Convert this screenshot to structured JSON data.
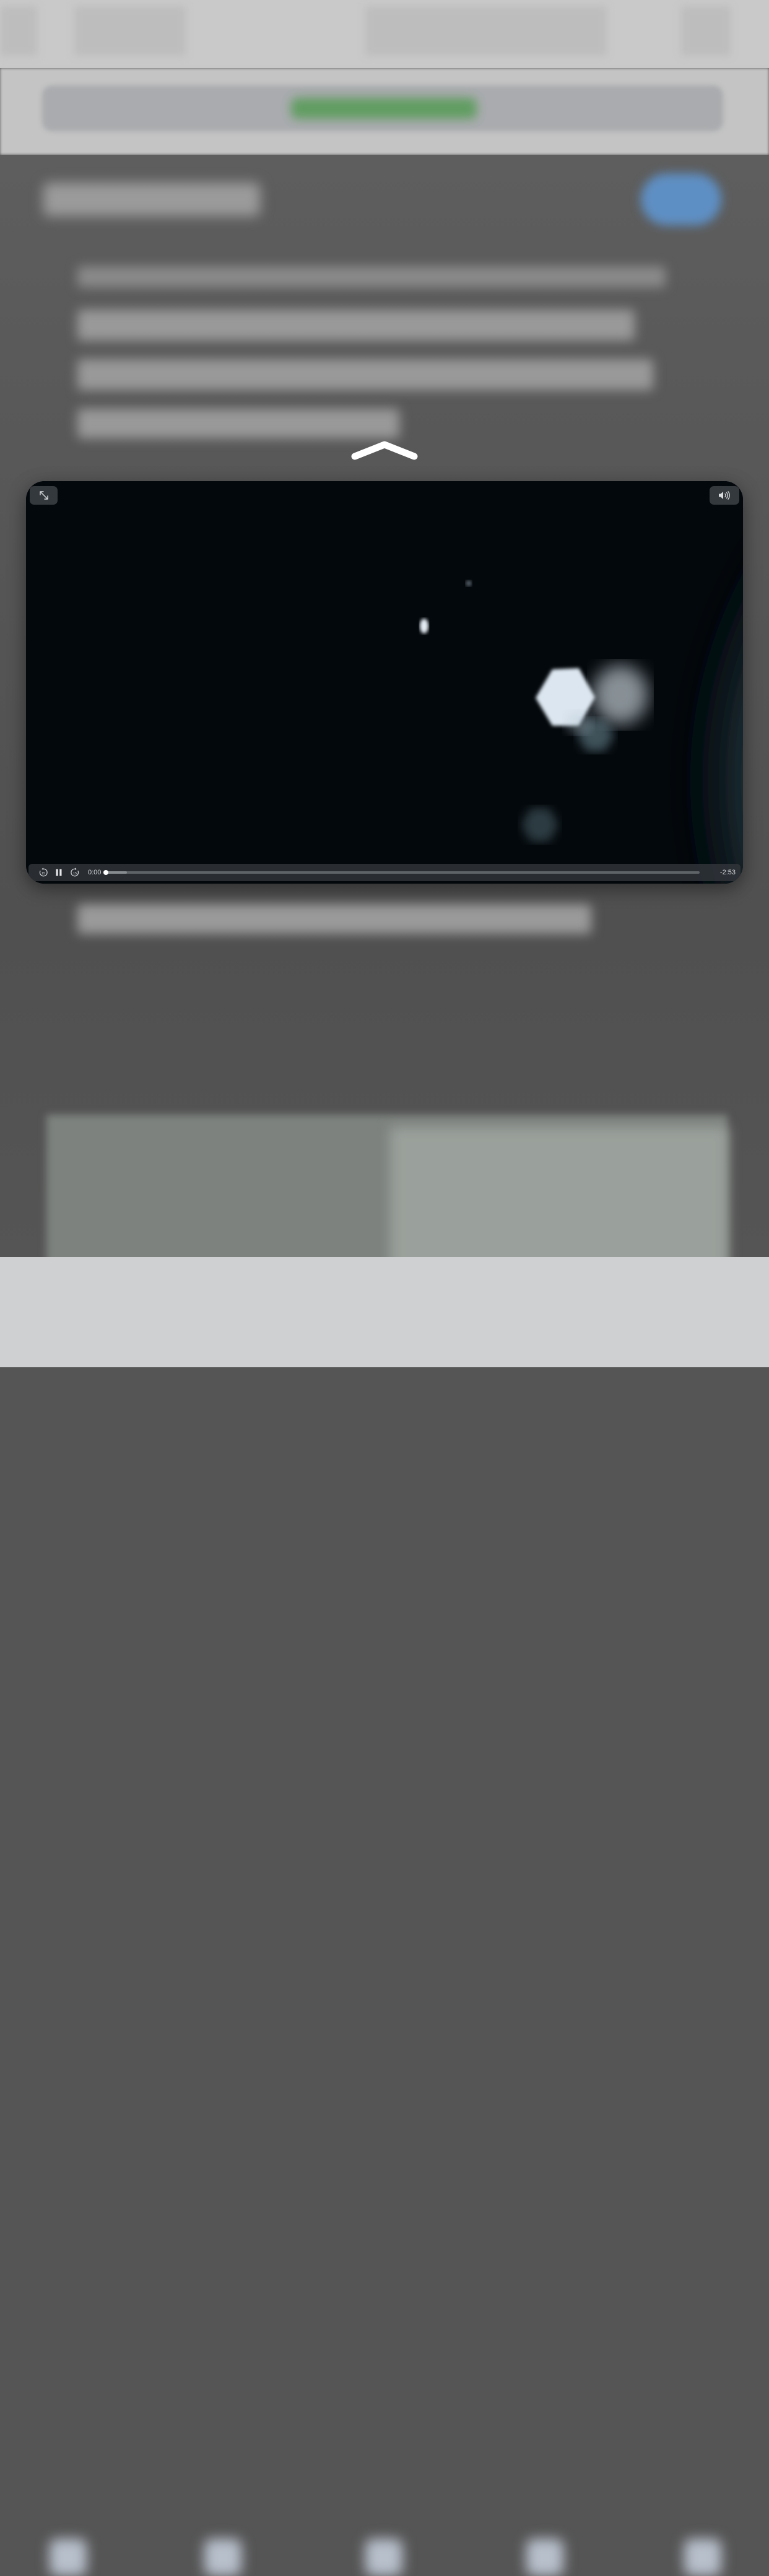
{
  "player": {
    "current_time": "0:00",
    "remaining_time": "-2:53",
    "progress": 0.0,
    "buffered": 0.036,
    "state": "playing",
    "icons": {
      "collapse": "chevron-up-icon",
      "expand": "expand-icon",
      "volume": "speaker-volume-icon",
      "skip_back": "skip-back-15-icon",
      "pause": "pause-icon",
      "skip_forward": "skip-forward-15-icon"
    },
    "skip_back_label": "15",
    "skip_forward_label": "15"
  },
  "colors": {
    "overlay": "#555555",
    "player_bg": "#03080c",
    "control_bar": "#32363a",
    "accent_green": "#4f9a4f",
    "accent_blue": "#5e8fc4"
  }
}
